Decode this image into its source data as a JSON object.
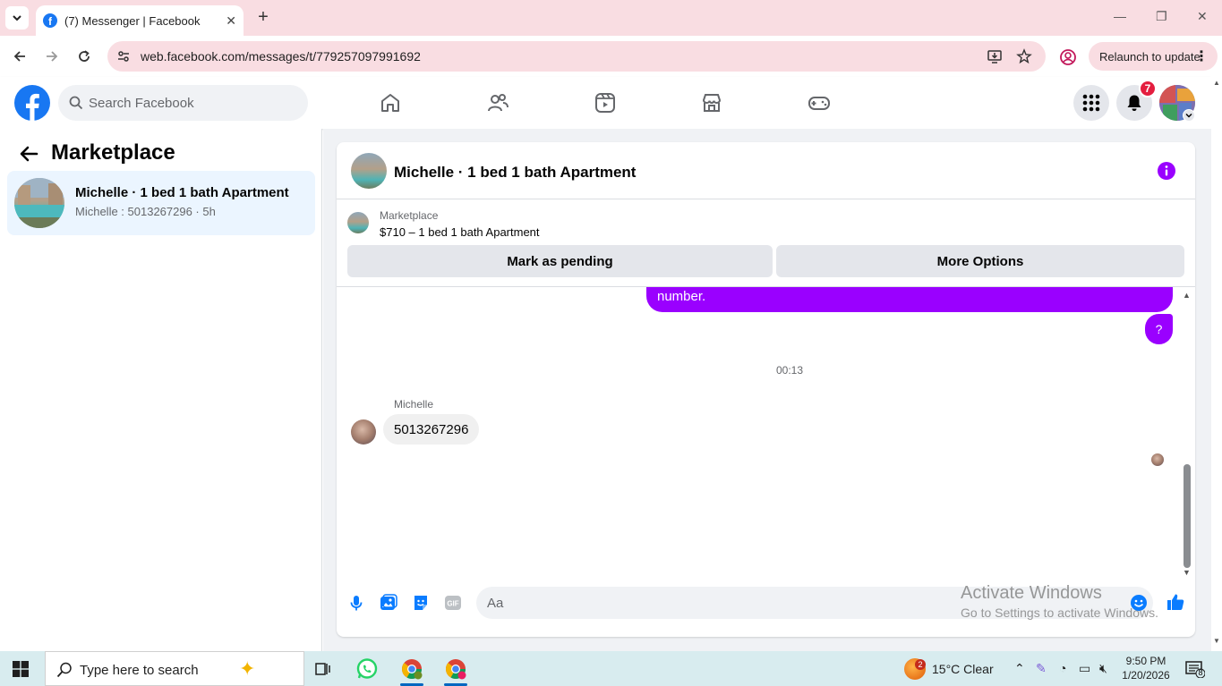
{
  "browser": {
    "tab_title": "(7) Messenger | Facebook",
    "url": "web.facebook.com/messages/t/779257097991692",
    "relaunch_label": "Relaunch to update"
  },
  "fb_header": {
    "search_placeholder": "Search Facebook",
    "notification_count": "7",
    "nav_items": [
      "home-icon",
      "friends-icon",
      "video-icon",
      "marketplace-icon",
      "gaming-icon"
    ]
  },
  "left_panel": {
    "title": "Marketplace",
    "conversations": [
      {
        "name": "Michelle · 1 bed 1 bath Apartment",
        "preview": "Michelle : 5013267296 · 5h"
      }
    ]
  },
  "chat": {
    "title": "Michelle · 1 bed 1 bath Apartment",
    "listing_kind": "Marketplace",
    "listing_title": "$710 – 1 bed 1 bath Apartment",
    "mark_pending_label": "Mark as pending",
    "more_options_label": "More Options",
    "messages": {
      "outgoing_text": "number.",
      "outgoing_short": "?",
      "timestamp": "00:13",
      "sender_name": "Michelle",
      "incoming_text": "5013267296"
    },
    "composer_placeholder": "Aa"
  },
  "watermark": {
    "line1": "Activate Windows",
    "line2": "Go to Settings to activate Windows."
  },
  "taskbar": {
    "search_text": "Type here to search",
    "weather_badge": "2",
    "temperature": "15°C  Clear",
    "time": "9:50 PM",
    "date": "1/20/2026",
    "notification_count": "8"
  },
  "colors": {
    "fb_blue": "#1877f2",
    "message_purple": "#9a00ff",
    "badge_red": "#e41e3f",
    "selected_conv": "#ebf5ff"
  }
}
